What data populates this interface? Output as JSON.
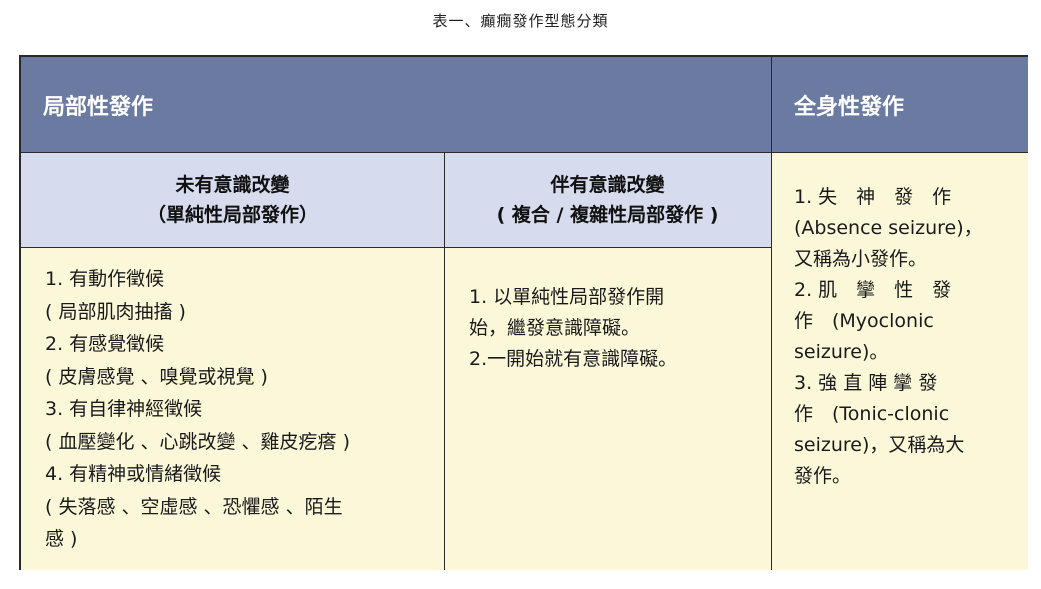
{
  "caption": "表一、癲癇發作型態分類",
  "headers": {
    "partial": "局部性發作",
    "generalized": "全身性發作"
  },
  "subheaders": {
    "simple": {
      "line1": "未有意識改變",
      "line2": "（單純性局部發作）"
    },
    "complex": {
      "line1": "伴有意識改變",
      "line2": "( 複合 / 複雜性局部發作 )"
    }
  },
  "simple_items": [
    "1. 有動作徵候",
    "( 局部肌肉抽搐 )",
    "2. 有感覺徵候",
    "( 皮膚感覺 、嗅覺或視覺 )",
    "3. 有自律神經徵候",
    "( 血壓變化 、心跳改變 、雞皮疙瘩 )",
    "4. 有精神或情緒徵候",
    "( 失落感 、空虛感 、恐懼感 、陌生",
    "感 )"
  ],
  "complex_items": [
    "1. 以單純性局部發作開",
    "始，繼發意識障礙。",
    "2.一開始就有意識障礙。"
  ],
  "generalized_items": [
    "1. 失　神　發　作",
    "(Absence seizure)，",
    "又稱為小發作。",
    "2. 肌　攣　性　發",
    "作　(Myoclonic",
    "seizure)。",
    "3. 強 直 陣 攣 發",
    "作　(Tonic-clonic",
    "seizure)，又稱為大",
    "發作。"
  ]
}
